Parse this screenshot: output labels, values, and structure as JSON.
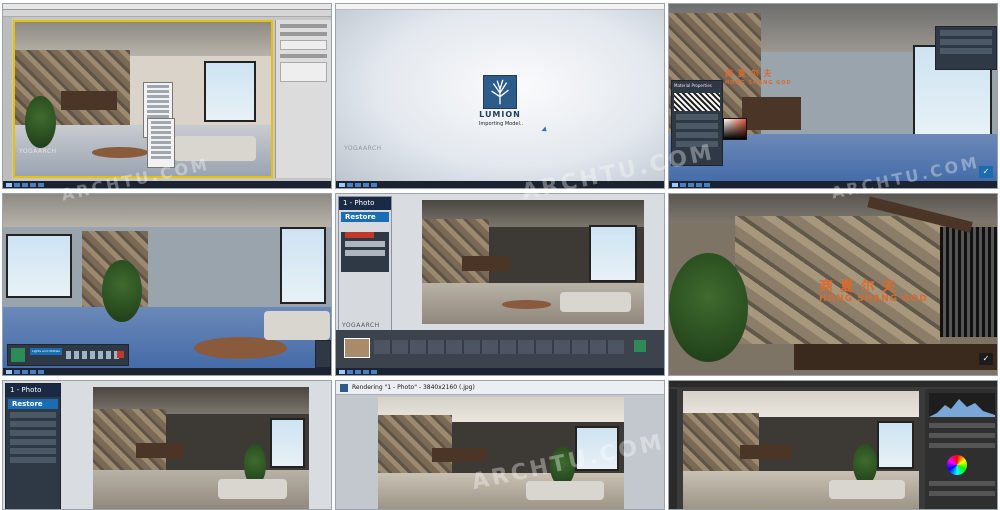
{
  "grid": {
    "rows": 3,
    "columns": 3
  },
  "tiles": {
    "t1": {
      "app": "3ds Max",
      "viewport_label": "YOGAARCH"
    },
    "t2": {
      "app": "Lumion",
      "logo_text": "LUMION",
      "status_text": "Importing Model..",
      "watermark": "YOGAARCH"
    },
    "t3": {
      "app": "Lumion",
      "panel_title": "Material Properties",
      "sign_cn": "商 夏 尔 夫",
      "sign_en": "HONG SHANG GOD"
    },
    "t4": {
      "app": "Lumion",
      "tool_label": "Lights and Utilities"
    },
    "t5": {
      "app": "Lumion",
      "mode_title": "1 - Photo",
      "button_label": "Restore",
      "watermark": "YOGAARCH"
    },
    "t6": {
      "app": "Lumion",
      "sign_cn": "商 夏 尔 夫",
      "sign_en": "HONG SHANG GOD"
    },
    "t7": {
      "app": "Lumion",
      "mode_title": "1 - Photo",
      "button_label": "Restore"
    },
    "t8": {
      "app": "Lumion",
      "render_title": "Rendering \"1 - Photo\" - 3840x2160 (.jpg)"
    },
    "t9": {
      "app": "Photoshop"
    }
  },
  "watermarks": {
    "big": [
      "ARCHTU.COM",
      "ARCHTU.COM",
      "ARCHTU.COM",
      "ARCHTU.COM"
    ]
  },
  "colors": {
    "lumion_blue": "#1a6db3",
    "taskbar": "#1b2230",
    "sign_orange": "#d96a2f"
  }
}
